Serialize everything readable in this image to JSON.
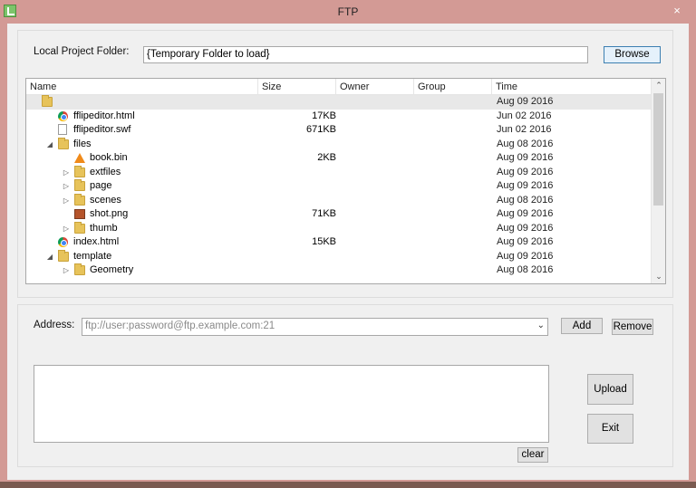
{
  "window": {
    "title": "FTP",
    "close_glyph": "×"
  },
  "local": {
    "label": "Local Project Folder:",
    "value": "{Temporary Folder to load}",
    "browse_label": "Browse"
  },
  "columns": [
    "Name",
    "Size",
    "Owner",
    "Group",
    "Time"
  ],
  "rows": [
    {
      "level": 0,
      "expander": "",
      "icon": "folder-icon",
      "name": "",
      "size": "",
      "time": "Aug 09 2016",
      "selected": true
    },
    {
      "level": 1,
      "expander": "",
      "icon": "chrome-icon",
      "name": "fflipeditor.html",
      "size": "17KB",
      "time": "Jun 02 2016"
    },
    {
      "level": 1,
      "expander": "",
      "icon": "file-icon",
      "name": "fflipeditor.swf",
      "size": "671KB",
      "time": "Jun 02 2016"
    },
    {
      "level": 1,
      "expander": "◢",
      "icon": "folder-icon",
      "name": "files",
      "size": "",
      "time": "Aug 08 2016"
    },
    {
      "level": 2,
      "expander": "",
      "icon": "cone-icon",
      "name": "book.bin",
      "size": "2KB",
      "time": "Aug 09 2016"
    },
    {
      "level": 2,
      "expander": "▷",
      "icon": "folder-icon",
      "name": "extfiles",
      "size": "",
      "time": "Aug 09 2016"
    },
    {
      "level": 2,
      "expander": "▷",
      "icon": "folder-icon",
      "name": "page",
      "size": "",
      "time": "Aug 09 2016"
    },
    {
      "level": 2,
      "expander": "▷",
      "icon": "folder-icon",
      "name": "scenes",
      "size": "",
      "time": "Aug 08 2016"
    },
    {
      "level": 2,
      "expander": "",
      "icon": "image-icon",
      "name": "shot.png",
      "size": "71KB",
      "time": "Aug 09 2016"
    },
    {
      "level": 2,
      "expander": "▷",
      "icon": "folder-icon",
      "name": "thumb",
      "size": "",
      "time": "Aug 09 2016"
    },
    {
      "level": 1,
      "expander": "",
      "icon": "chrome-icon",
      "name": "index.html",
      "size": "15KB",
      "time": "Aug 09 2016"
    },
    {
      "level": 1,
      "expander": "◢",
      "icon": "folder-icon",
      "name": "template",
      "size": "",
      "time": "Aug 09 2016"
    },
    {
      "level": 2,
      "expander": "▷",
      "icon": "folder-icon",
      "name": "Geometry",
      "size": "",
      "time": "Aug 08 2016"
    }
  ],
  "scroll": {
    "up": "⌃",
    "down": "⌄"
  },
  "address": {
    "label": "Address:",
    "value": "ftp://user:password@ftp.example.com:21",
    "arrow": "⌄",
    "add_label": "Add",
    "remove_label": "Remove"
  },
  "actions": {
    "upload_label": "Upload",
    "exit_label": "Exit",
    "clear_label": "clear"
  },
  "colors": {
    "titlebar": "#d39a95",
    "client": "#f0f0f0",
    "selected_row": "#e8e8e8"
  }
}
